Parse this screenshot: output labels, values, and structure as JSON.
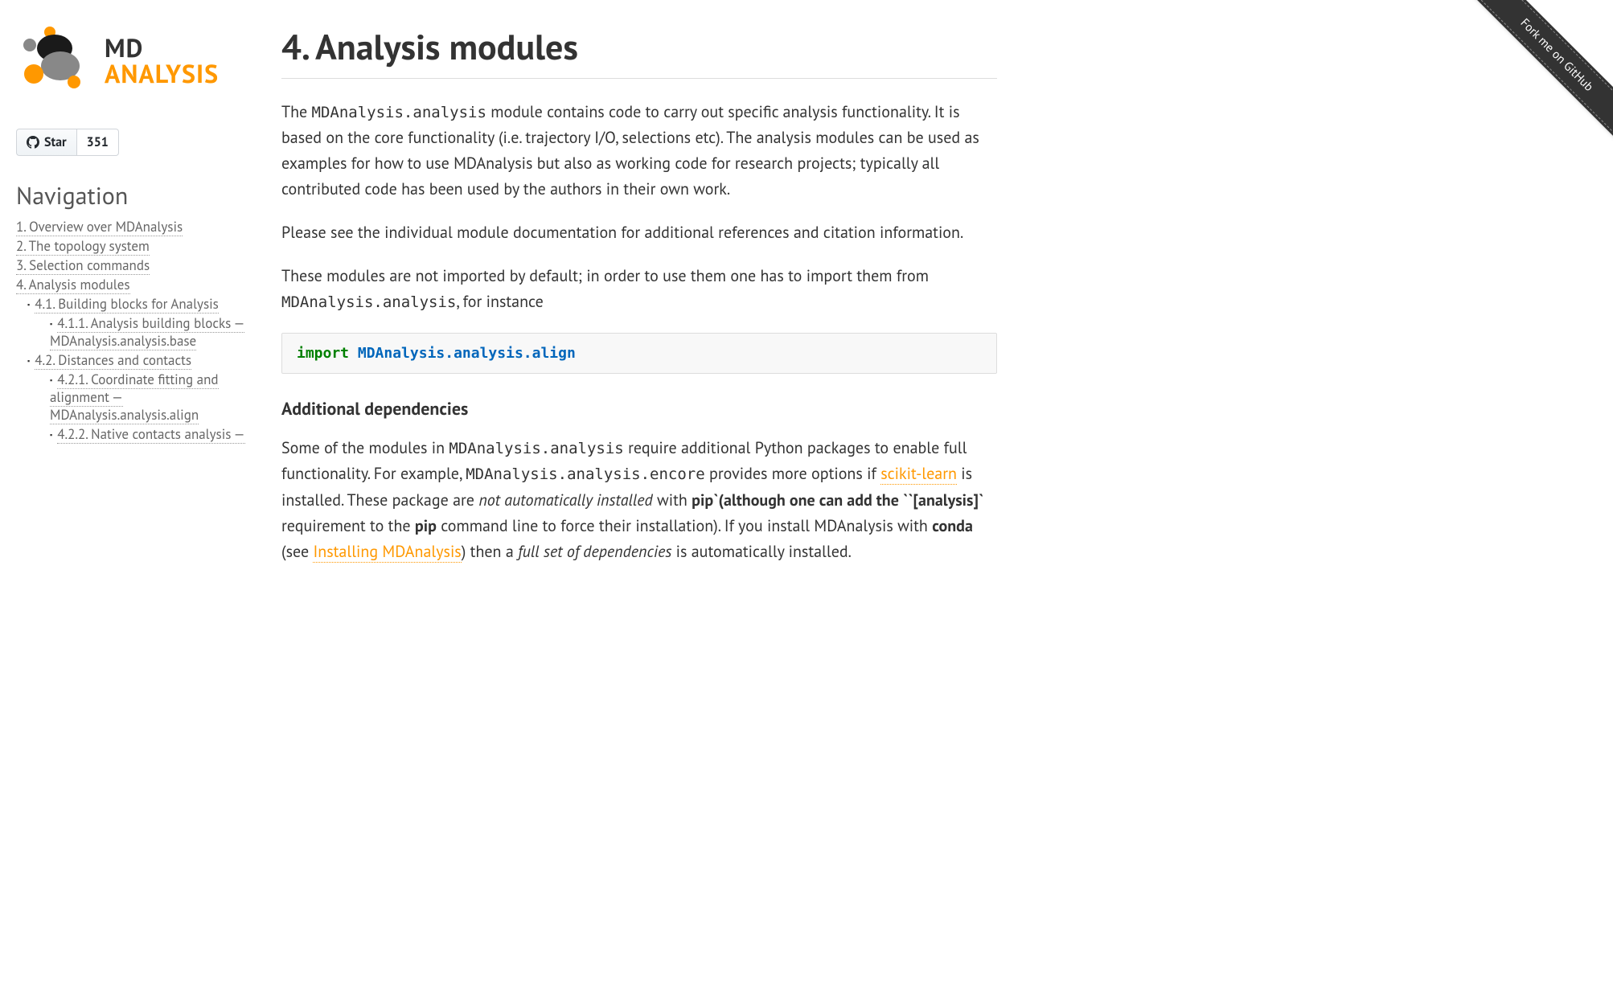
{
  "ribbon": {
    "text": "Fork me on GitHub"
  },
  "logo": {
    "line1": "MD",
    "line2": "ANALYSIS"
  },
  "github": {
    "star_label": "Star",
    "star_count": "351"
  },
  "nav": {
    "heading": "Navigation",
    "items": [
      {
        "label": "1. Overview over MDAnalysis"
      },
      {
        "label": "2. The topology system"
      },
      {
        "label": "3. Selection commands"
      },
      {
        "label": "4. Analysis modules"
      }
    ],
    "sub": [
      {
        "label": "4.1. Building blocks for Analysis"
      },
      {
        "label": "4.2. Distances and contacts"
      }
    ],
    "sub_4_1": [
      {
        "label": "4.1.1. Analysis building blocks — MDAnalysis.analysis.base"
      }
    ],
    "sub_4_2": [
      {
        "label": "4.2.1. Coordinate fitting and alignment — MDAnalysis.analysis.align"
      },
      {
        "label": "4.2.2. Native contacts analysis —"
      }
    ]
  },
  "page": {
    "title": "4. Analysis modules",
    "p1_a": "The ",
    "p1_code": "MDAnalysis.analysis",
    "p1_b": " module contains code to carry out specific analysis functionality. It is based on the core functionality (i.e. trajectory I/O, selections etc). The analysis modules can be used as examples for how to use MDAnalysis but also as working code for research projects; typically all contributed code has been used by the authors in their own work.",
    "p2": "Please see the individual module documentation for additional references and citation information.",
    "p3_a": "These modules are not imported by default; in order to use them one has to import them from ",
    "p3_code": "MDAnalysis.analysis",
    "p3_b": ", for instance",
    "code_import": "import",
    "code_module": "MDAnalysis.analysis.align",
    "subhead": "Additional dependencies",
    "p4_a": "Some of the modules in ",
    "p4_code1": "MDAnalysis.analysis",
    "p4_b": " require additional Python packages to enable full functionality. For example, ",
    "p4_code2": "MDAnalysis.analysis.encore",
    "p4_c": " provides more options if ",
    "p4_link1": "scikit-learn",
    "p4_d": " is installed. These package are ",
    "p4_em1": "not automatically installed",
    "p4_e": " with ",
    "p4_strong1": "pip`(although one can add the ``[analysis]`",
    "p4_f": " requirement to the ",
    "p4_strong2": "pip",
    "p4_g": " command line to force their installation). If you install MDAnalysis with ",
    "p4_strong3": "conda",
    "p4_h": " (see ",
    "p4_link2": "Installing MDAnalysis",
    "p4_i": ") then a ",
    "p4_em2": "full set of dependencies",
    "p4_j": " is automatically installed."
  }
}
